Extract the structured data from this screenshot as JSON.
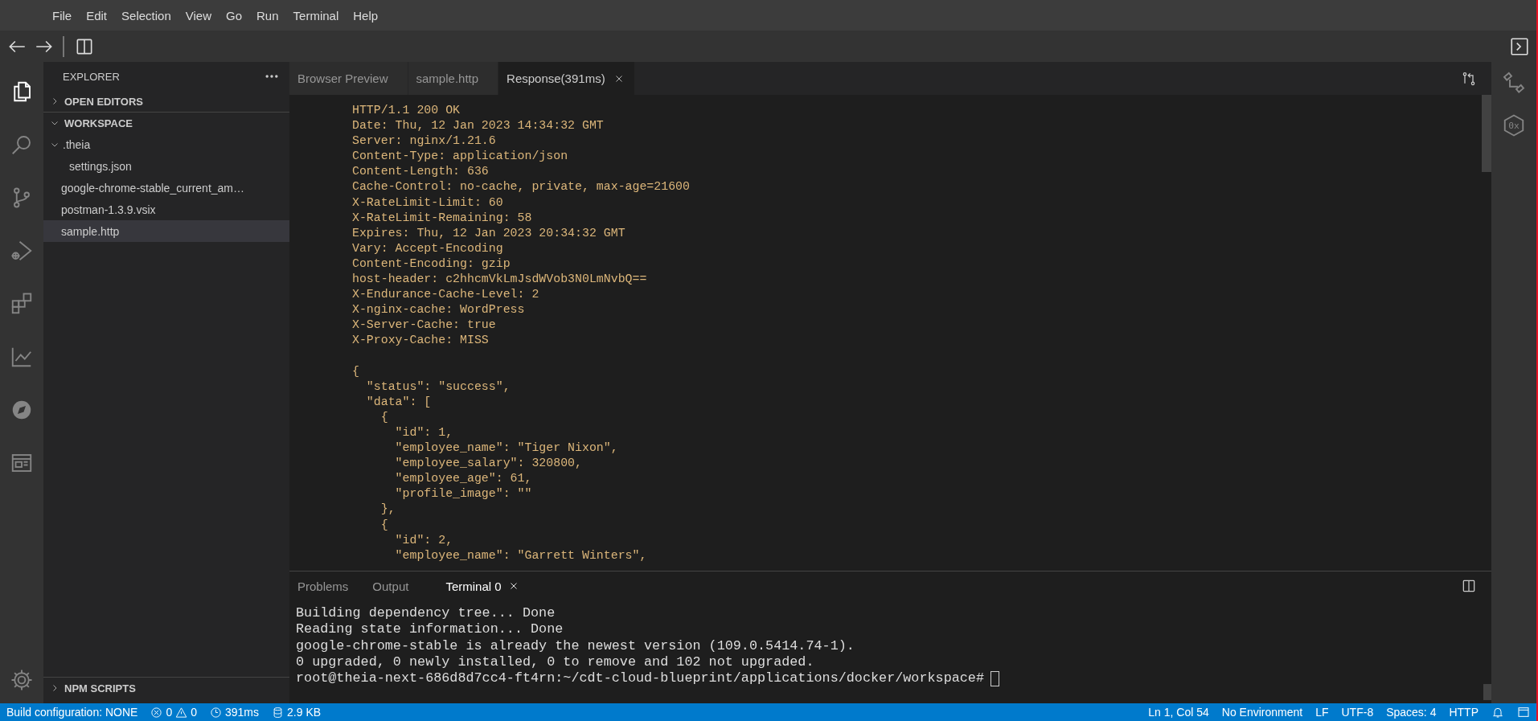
{
  "menu": [
    "File",
    "Edit",
    "Selection",
    "View",
    "Go",
    "Run",
    "Terminal",
    "Help"
  ],
  "activity_bar": [
    {
      "kind": "files",
      "selected": true
    },
    {
      "kind": "search",
      "selected": false
    },
    {
      "kind": "branch",
      "selected": false
    },
    {
      "kind": "debug",
      "selected": false
    },
    {
      "kind": "extensions",
      "selected": false
    },
    {
      "kind": "chart",
      "selected": false
    },
    {
      "kind": "compass",
      "selected": false
    },
    {
      "kind": "browser",
      "selected": false
    }
  ],
  "sidebar": {
    "title": "EXPLORER",
    "sections": [
      {
        "label": "OPEN EDITORS",
        "expanded": false
      },
      {
        "label": "WORKSPACE",
        "expanded": true,
        "items": [
          {
            "label": ".theia",
            "expanded": true,
            "selected": false,
            "children": [
              {
                "label": "settings.json",
                "selected": false
              }
            ]
          },
          {
            "label": "google-chrome-stable_current_am…",
            "selected": false
          },
          {
            "label": "postman-1.3.9.vsix",
            "selected": false
          },
          {
            "label": "sample.http",
            "selected": true
          }
        ]
      }
    ],
    "bottom_section": {
      "label": "NPM SCRIPTS",
      "expanded": false
    }
  },
  "editor": {
    "tabs": [
      {
        "label": "Browser Preview",
        "selected": false,
        "closable": false
      },
      {
        "label": "sample.http",
        "selected": false,
        "closable": false
      },
      {
        "label": "Response(391ms)",
        "selected": true,
        "closable": true
      }
    ],
    "headers": [
      "HTTP/1.1 200 OK",
      "Date: Thu, 12 Jan 2023 14:34:32 GMT",
      "Server: nginx/1.21.6",
      "Content-Type: application/json",
      "Content-Length: 636",
      "Cache-Control: no-cache, private, max-age=21600",
      "X-RateLimit-Limit: 60",
      "X-RateLimit-Remaining: 58",
      "Expires: Thu, 12 Jan 2023 20:34:32 GMT",
      "Vary: Accept-Encoding",
      "Content-Encoding: gzip",
      "host-header: c2hhcmVkLmJsdWVob3N0LmNvbQ==",
      "X-Endurance-Cache-Level: 2",
      "X-nginx-cache: WordPress",
      "X-Server-Cache: true",
      "X-Proxy-Cache: MISS"
    ],
    "body": [
      "{",
      "  \"status\": \"success\",",
      "  \"data\": [",
      "    {",
      "      \"id\": 1,",
      "      \"employee_name\": \"Tiger Nixon\",",
      "      \"employee_salary\": 320800,",
      "      \"employee_age\": 61,",
      "      \"profile_image\": \"\"",
      "    },",
      "    {",
      "      \"id\": 2,",
      "      \"employee_name\": \"Garrett Winters\","
    ]
  },
  "panel": {
    "tabs": [
      {
        "label": "Problems",
        "selected": false,
        "closable": false
      },
      {
        "label": "Output",
        "selected": false,
        "closable": false
      },
      {
        "label": "Terminal 0",
        "selected": true,
        "closable": true
      }
    ],
    "lines": [
      "Building dependency tree... Done",
      "Reading state information... Done",
      "google-chrome-stable is already the newest version (109.0.5414.74-1).",
      "0 upgraded, 0 newly installed, 0 to remove and 102 not upgraded."
    ],
    "prompt": "root@theia-next-686d8d7cc4-ft4rn:~/cdt-cloud-blueprint/applications/docker/workspace#"
  },
  "right_bar": [
    {
      "kind": "hierarchy"
    },
    {
      "kind": "hex",
      "text": "0x"
    }
  ],
  "status_bar": {
    "left": [
      {
        "kind": "text",
        "text": "Build configuration: NONE"
      },
      {
        "kind": "problems",
        "errors": "0",
        "warnings": "0"
      },
      {
        "kind": "clock",
        "text": "391ms"
      },
      {
        "kind": "database",
        "text": "2.9 KB"
      }
    ],
    "right": [
      {
        "kind": "text",
        "text": "Ln 1, Col 54"
      },
      {
        "kind": "text",
        "text": "No Environment"
      },
      {
        "kind": "text",
        "text": "LF"
      },
      {
        "kind": "text",
        "text": "UTF-8"
      },
      {
        "kind": "text",
        "text": "Spaces: 4"
      },
      {
        "kind": "text",
        "text": "HTTP"
      },
      {
        "kind": "bell"
      },
      {
        "kind": "layout"
      }
    ]
  }
}
